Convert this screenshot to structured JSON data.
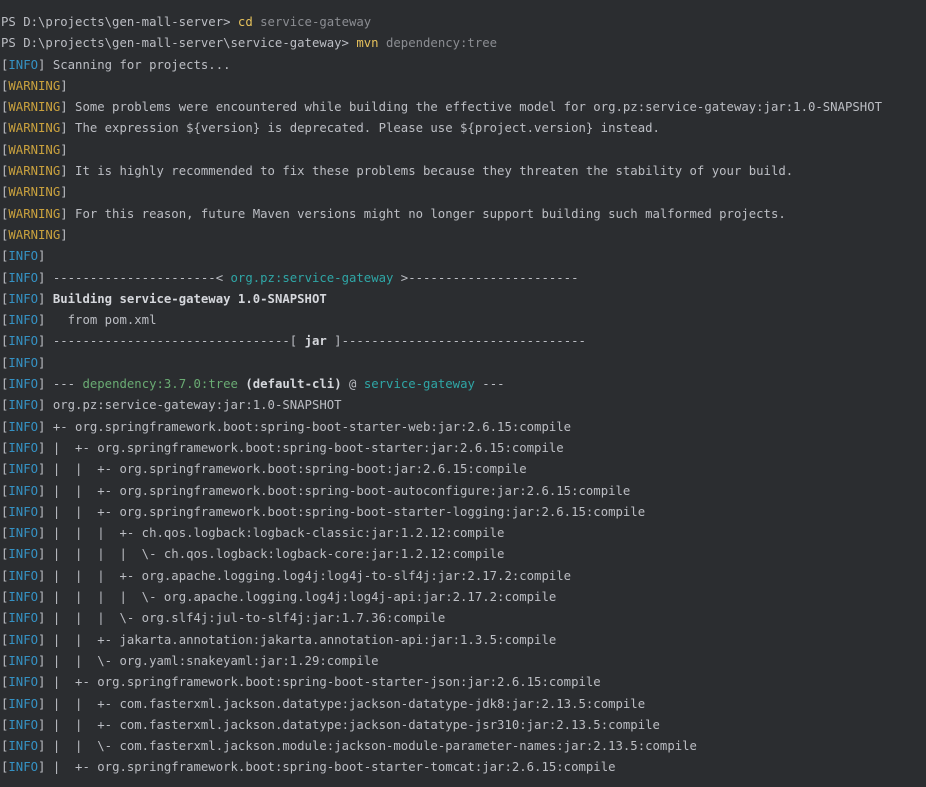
{
  "terminal": {
    "lines": [
      {
        "segments": [
          [
            "plain",
            "PS D:\\projects\\gen-mall-server> "
          ],
          [
            "cmd",
            "cd "
          ],
          [
            "arg",
            "service-gateway"
          ]
        ]
      },
      {
        "segments": [
          [
            "plain",
            "PS D:\\projects\\gen-mall-server\\service-gateway> "
          ],
          [
            "cmd",
            "mvn "
          ],
          [
            "arg",
            "dependency:tree"
          ]
        ]
      },
      {
        "tag": "INFO",
        "segments": [
          [
            "plain",
            " Scanning for projects..."
          ]
        ]
      },
      {
        "tag": "WARNING",
        "segments": []
      },
      {
        "tag": "WARNING",
        "segments": [
          [
            "plain",
            " Some problems were encountered while building the effective model for org.pz:service-gateway:jar:1.0-SNAPSHOT"
          ]
        ]
      },
      {
        "tag": "WARNING",
        "segments": [
          [
            "plain",
            " The expression ${version} is deprecated. Please use ${project.version} instead."
          ]
        ]
      },
      {
        "tag": "WARNING",
        "segments": []
      },
      {
        "tag": "WARNING",
        "segments": [
          [
            "plain",
            " It is highly recommended to fix these problems because they threaten the stability of your build."
          ]
        ]
      },
      {
        "tag": "WARNING",
        "segments": []
      },
      {
        "tag": "WARNING",
        "segments": [
          [
            "plain",
            " For this reason, future Maven versions might no longer support building such malformed projects."
          ]
        ]
      },
      {
        "tag": "WARNING",
        "segments": []
      },
      {
        "tag": "INFO",
        "segments": []
      },
      {
        "tag": "INFO",
        "segments": [
          [
            "plain",
            " ----------------------< "
          ],
          [
            "hl",
            "org.pz:service-gateway"
          ],
          [
            "plain",
            " >-----------------------"
          ]
        ]
      },
      {
        "tag": "INFO",
        "segments": [
          [
            "bold",
            " Building service-gateway 1.0-SNAPSHOT"
          ]
        ]
      },
      {
        "tag": "INFO",
        "segments": [
          [
            "plain",
            "   from pom.xml"
          ]
        ]
      },
      {
        "tag": "INFO",
        "segments": [
          [
            "plain",
            " --------------------------------[ "
          ],
          [
            "bold",
            "jar"
          ],
          [
            "plain",
            " ]---------------------------------"
          ]
        ]
      },
      {
        "tag": "INFO",
        "segments": []
      },
      {
        "tag": "INFO",
        "segments": [
          [
            "plain",
            " --- "
          ],
          [
            "green",
            "dependency:3.7.0:tree"
          ],
          [
            "bold",
            " (default-cli)"
          ],
          [
            "plain",
            " @ "
          ],
          [
            "hl",
            "service-gateway"
          ],
          [
            "plain",
            " ---"
          ]
        ]
      },
      {
        "tag": "INFO",
        "segments": [
          [
            "plain",
            " org.pz:service-gateway:jar:1.0-SNAPSHOT"
          ]
        ]
      },
      {
        "tag": "INFO",
        "segments": [
          [
            "plain",
            " +- org.springframework.boot:spring-boot-starter-web:jar:2.6.15:compile"
          ]
        ]
      },
      {
        "tag": "INFO",
        "segments": [
          [
            "plain",
            " |  +- org.springframework.boot:spring-boot-starter:jar:2.6.15:compile"
          ]
        ]
      },
      {
        "tag": "INFO",
        "segments": [
          [
            "plain",
            " |  |  +- org.springframework.boot:spring-boot:jar:2.6.15:compile"
          ]
        ]
      },
      {
        "tag": "INFO",
        "segments": [
          [
            "plain",
            " |  |  +- org.springframework.boot:spring-boot-autoconfigure:jar:2.6.15:compile"
          ]
        ]
      },
      {
        "tag": "INFO",
        "segments": [
          [
            "plain",
            " |  |  +- org.springframework.boot:spring-boot-starter-logging:jar:2.6.15:compile"
          ]
        ]
      },
      {
        "tag": "INFO",
        "segments": [
          [
            "plain",
            " |  |  |  +- ch.qos.logback:logback-classic:jar:1.2.12:compile"
          ]
        ]
      },
      {
        "tag": "INFO",
        "segments": [
          [
            "plain",
            " |  |  |  |  \\- ch.qos.logback:logback-core:jar:1.2.12:compile"
          ]
        ]
      },
      {
        "tag": "INFO",
        "segments": [
          [
            "plain",
            " |  |  |  +- org.apache.logging.log4j:log4j-to-slf4j:jar:2.17.2:compile"
          ]
        ]
      },
      {
        "tag": "INFO",
        "segments": [
          [
            "plain",
            " |  |  |  |  \\- org.apache.logging.log4j:log4j-api:jar:2.17.2:compile"
          ]
        ]
      },
      {
        "tag": "INFO",
        "segments": [
          [
            "plain",
            " |  |  |  \\- org.slf4j:jul-to-slf4j:jar:1.7.36:compile"
          ]
        ]
      },
      {
        "tag": "INFO",
        "segments": [
          [
            "plain",
            " |  |  +- jakarta.annotation:jakarta.annotation-api:jar:1.3.5:compile"
          ]
        ]
      },
      {
        "tag": "INFO",
        "segments": [
          [
            "plain",
            " |  |  \\- org.yaml:snakeyaml:jar:1.29:compile"
          ]
        ]
      },
      {
        "tag": "INFO",
        "segments": [
          [
            "plain",
            " |  +- org.springframework.boot:spring-boot-starter-json:jar:2.6.15:compile"
          ]
        ]
      },
      {
        "tag": "INFO",
        "segments": [
          [
            "plain",
            " |  |  +- com.fasterxml.jackson.datatype:jackson-datatype-jdk8:jar:2.13.5:compile"
          ]
        ]
      },
      {
        "tag": "INFO",
        "segments": [
          [
            "plain",
            " |  |  +- com.fasterxml.jackson.datatype:jackson-datatype-jsr310:jar:2.13.5:compile"
          ]
        ]
      },
      {
        "tag": "INFO",
        "segments": [
          [
            "plain",
            " |  |  \\- com.fasterxml.jackson.module:jackson-module-parameter-names:jar:2.13.5:compile"
          ]
        ]
      },
      {
        "tag": "INFO",
        "segments": [
          [
            "plain",
            " |  +- org.springframework.boot:spring-boot-starter-tomcat:jar:2.6.15:compile"
          ]
        ]
      }
    ]
  },
  "colors": {
    "background": "#2b2d30",
    "text": "#bcbec4",
    "info_tag": "#3592c4",
    "warning_tag": "#c9a13e",
    "command": "#e6c15c",
    "highlight": "#2fa6a6",
    "plugin": "#6aab73"
  }
}
